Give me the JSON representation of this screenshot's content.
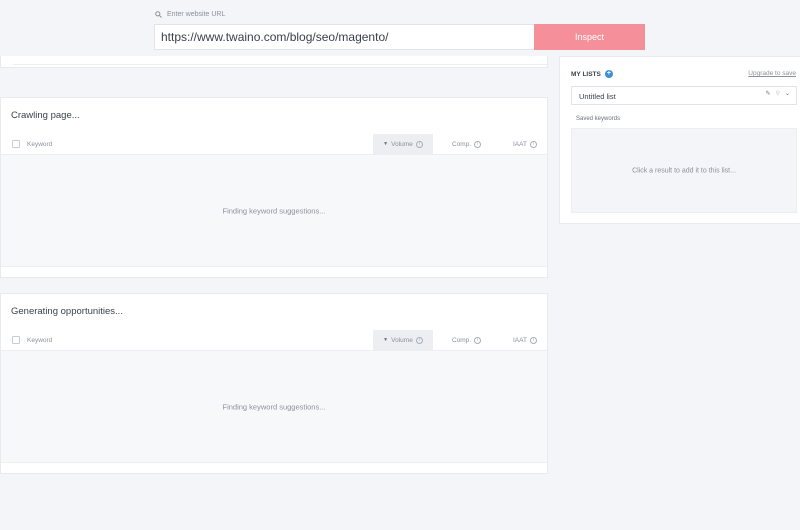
{
  "url_bar": {
    "label": "Enter website URL",
    "value": "https://www.twaino.com/blog/seo/magento/",
    "button_label": "Inspect"
  },
  "panels": [
    {
      "title": "Crawling page...",
      "columns": {
        "keyword": "Keyword",
        "volume": "Volume",
        "comp": "Comp.",
        "iaat": "IAAT"
      },
      "empty_message": "Finding keyword suggestions..."
    },
    {
      "title": "Generating opportunities...",
      "columns": {
        "keyword": "Keyword",
        "volume": "Volume",
        "comp": "Comp.",
        "iaat": "IAAT"
      },
      "empty_message": "Finding keyword suggestions..."
    }
  ],
  "sidebar": {
    "title": "MY LISTS",
    "upgrade_link": "Upgrade to save",
    "list_name": "Untitled list",
    "saved_label": "Saved keywords",
    "empty_message": "Click a result to add it to this list..."
  },
  "colors": {
    "inspect_button": "#f5909a",
    "accent_blue": "#3b8ed8",
    "background": "#f4f5f8"
  }
}
